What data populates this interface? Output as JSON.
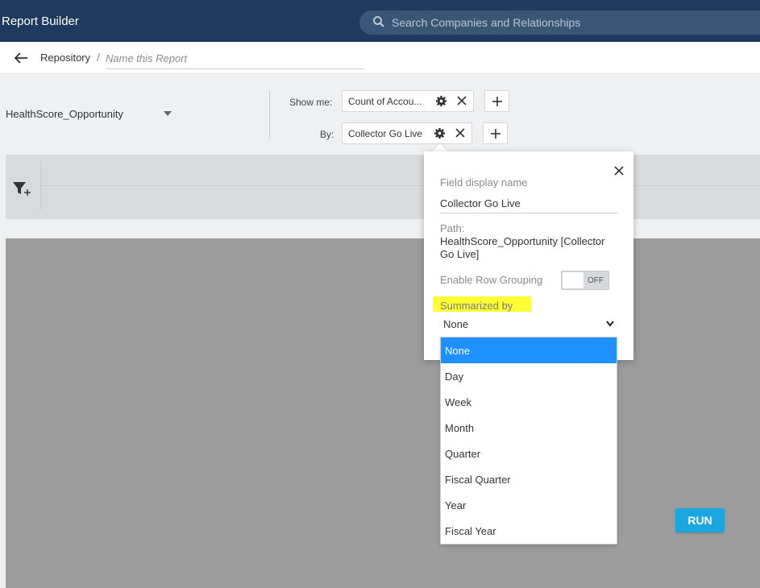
{
  "header": {
    "app_title": "Report Builder",
    "search_placeholder": "Search Companies and Relationships"
  },
  "breadcrumb": {
    "repository_label": "Repository",
    "separator": "/",
    "report_name_placeholder": "Name this Report"
  },
  "source": {
    "selected": "HealthScore_Opportunity"
  },
  "show_me": {
    "label": "Show me:",
    "field": "Count of Accou..."
  },
  "by": {
    "label": "By:",
    "field": "Collector Go Live"
  },
  "field_popover": {
    "display_name_label": "Field display name",
    "display_name_value": "Collector Go Live",
    "path_label": "Path:",
    "path_value": "HealthScore_Opportunity [Collector Go Live]",
    "row_grouping_label": "Enable Row Grouping",
    "row_grouping_state": "OFF",
    "summarized_by_label": "Summarized by",
    "summarized_by_value": "None",
    "options": [
      "None",
      "Day",
      "Week",
      "Month",
      "Quarter",
      "Fiscal Quarter",
      "Year",
      "Fiscal Year"
    ],
    "highlight_color": "#ffff33"
  },
  "actions": {
    "run_label": "RUN"
  },
  "colors": {
    "header_bg": "#1e3a5f",
    "accent": "#1aa7e0",
    "selected_option": "#1e90ff"
  }
}
